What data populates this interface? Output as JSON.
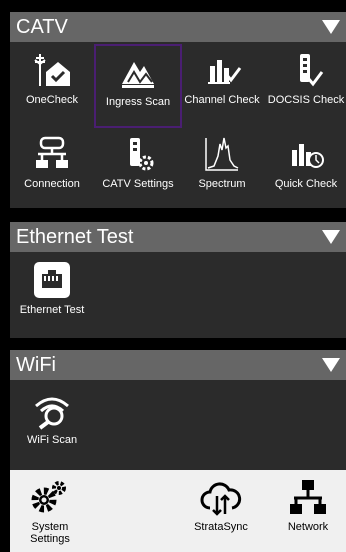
{
  "sections": {
    "catv": {
      "title": "CATV",
      "tiles": [
        {
          "label": "OneCheck",
          "icon": "onecheck-icon"
        },
        {
          "label": "Ingress Scan",
          "icon": "ingress-scan-icon"
        },
        {
          "label": "Channel Check",
          "icon": "channel-check-icon"
        },
        {
          "label": "DOCSIS Check",
          "icon": "docsis-check-icon"
        },
        {
          "label": "Connection",
          "icon": "connection-icon"
        },
        {
          "label": "CATV Settings",
          "icon": "catv-settings-icon"
        },
        {
          "label": "Spectrum",
          "icon": "spectrum-icon"
        },
        {
          "label": "Quick Check",
          "icon": "quick-check-icon"
        }
      ]
    },
    "ethernet": {
      "title": "Ethernet Test",
      "tiles": [
        {
          "label": "Ethernet Test",
          "icon": "ethernet-icon"
        }
      ]
    },
    "wifi": {
      "title": "WiFi",
      "tiles": [
        {
          "label": "WiFi Scan",
          "icon": "wifi-scan-icon"
        }
      ]
    }
  },
  "bottom": {
    "system_settings": {
      "line1": "System",
      "line2": "Settings"
    },
    "stratasync": "StrataSync",
    "network": "Network"
  },
  "colors": {
    "header_bg": "#666666",
    "body_bg": "#2b2b2b",
    "selected_outline": "#4a1e72"
  }
}
